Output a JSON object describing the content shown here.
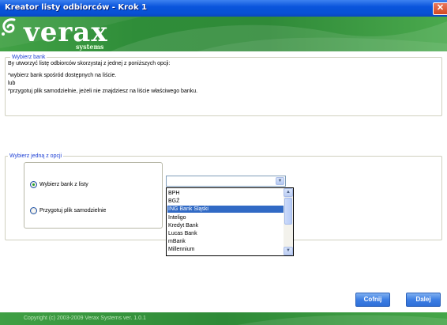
{
  "window": {
    "title": "Kreator listy odbiorców - Krok 1",
    "close_glyph": "✕"
  },
  "header": {
    "logo_text": "verax",
    "logo_sub": "systems"
  },
  "bank_info": {
    "legend": "Wybierz bank",
    "line1": "By utworzyć listę odbiorców skorzystaj z jednej z poniższych opcji:",
    "line2": "*wybierz bank spośród dostępnych na liście.",
    "line3": "lub",
    "line4": "*przygotuj plik samodzielnie, jeżeli nie znajdziesz na liście właściwego banku."
  },
  "options": {
    "legend": "Wybierz jedną z opcji",
    "radio_list_label": "Wybierz bank z listy",
    "radio_list_checked": true,
    "radio_file_label": "Przygotuj plik samodzielnie",
    "radio_file_checked": false
  },
  "bank_select": {
    "value": "",
    "items": [
      "BPH",
      "BGŻ",
      "ING Bank Śląski",
      "Inteligo",
      "Kredyt Bank",
      "Lucas Bank",
      "mBank",
      "Millennium"
    ],
    "selected_index": 2
  },
  "buttons": {
    "back": "Cofnij",
    "next": "Dalej"
  },
  "footer": {
    "copyright": "Copyright (c) 2003-2009 Verax Systems   ver. 1.0.1"
  },
  "colors": {
    "titlebar": "#0a55dc",
    "brand_green": "#2f8d39",
    "legend_blue": "#1c3fd4",
    "selection": "#316ac5"
  }
}
